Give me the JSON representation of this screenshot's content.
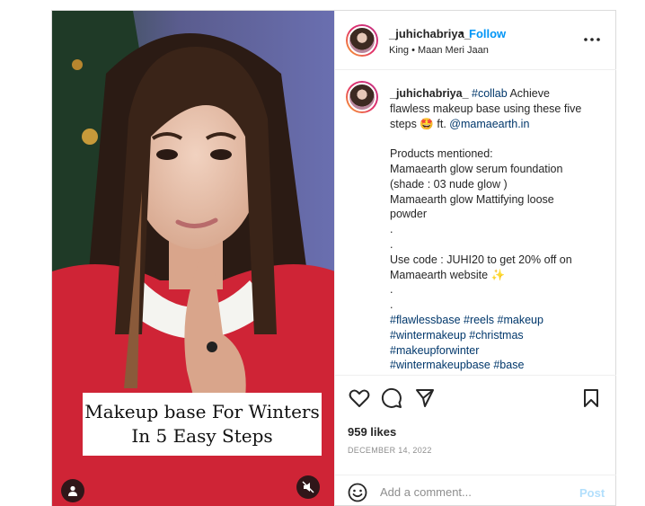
{
  "post": {
    "username": "_juhichabriya_",
    "separator": "•",
    "follow_label": "Follow",
    "audio": "King • Maan Meri Jaan",
    "more_icon": "more-horizontal-icon"
  },
  "media": {
    "overlay_line1": "Makeup base For Winters",
    "overlay_line2": "In 5 Easy Steps"
  },
  "caption": {
    "username": "_juhichabriya_",
    "line1_tag": "#collab",
    "line1_rest": " Achieve",
    "line2": "flawless makeup base using these five",
    "line3_pre": "steps 🤩 ft. ",
    "line3_mention": "@mamaearth.in",
    "line4": "Products mentioned:",
    "line5": "Mamaearth glow serum foundation",
    "line6": "(shade : 03 nude glow )",
    "line7": "Mamaearth glow Mattifying loose",
    "line8": "powder",
    "dot1": ".",
    "dot2": ".",
    "line9": "Use code : JUHI20 to get 20% off on",
    "line10": "Mamaearth website ✨",
    "dot3": ".",
    "dot4": ".",
    "hashtags1": "#flawlessbase #reels #makeup",
    "hashtags2": "#wintermakeup #christmas",
    "hashtags3": "#makeupforwinter",
    "hashtags4": "#wintermakeupbase #base"
  },
  "stats": {
    "likes": "959 likes",
    "date": "DECEMBER 14, 2022"
  },
  "comment": {
    "placeholder": "Add a comment...",
    "post_label": "Post"
  }
}
